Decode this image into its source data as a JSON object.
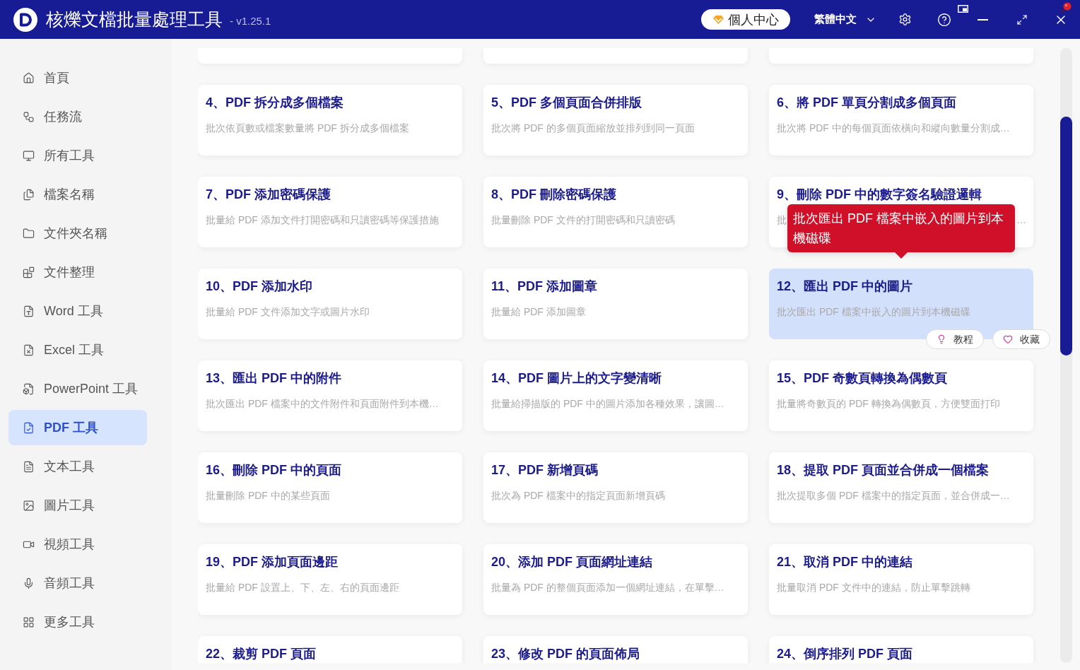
{
  "window": {
    "title": "核爍文檔批量處理工具",
    "version": "- v1.25.1"
  },
  "header": {
    "account_button": "個人中心",
    "language": "繁體中文"
  },
  "sidebar": {
    "items": [
      {
        "label": "首頁",
        "selected": false
      },
      {
        "label": "任務流",
        "selected": false
      },
      {
        "label": "所有工具",
        "selected": false
      },
      {
        "label": "檔案名稱",
        "selected": false
      },
      {
        "label": "文件夾名稱",
        "selected": false
      },
      {
        "label": "文件整理",
        "selected": false
      },
      {
        "label": "Word 工具",
        "selected": false
      },
      {
        "label": "Excel 工具",
        "selected": false
      },
      {
        "label": "PowerPoint 工具",
        "selected": false
      },
      {
        "label": "PDF 工具",
        "selected": true
      },
      {
        "label": "文本工具",
        "selected": false
      },
      {
        "label": "圖片工具",
        "selected": false
      },
      {
        "label": "視頻工具",
        "selected": false
      },
      {
        "label": "音頻工具",
        "selected": false
      },
      {
        "label": "更多工具",
        "selected": false
      }
    ]
  },
  "cards": [
    {
      "title": "4、PDF 拆分成多個檔案",
      "description": "批次依頁數或檔案數量將 PDF 拆分成多個檔案",
      "hovered": false
    },
    {
      "title": "5、PDF 多個頁面合併排版",
      "description": "批次將 PDF 的多個頁面縮放並排列到同一頁面",
      "hovered": false
    },
    {
      "title": "6、將 PDF 單頁分割成多個頁面",
      "description": "批次將 PDF 中的每個頁面依橫向和縱向數量分割成…",
      "hovered": false
    },
    {
      "title": "7、PDF 添加密碼保護",
      "description": "批量給 PDF 添加文件打開密碼和只讀密碼等保護措施",
      "hovered": false
    },
    {
      "title": "8、PDF 刪除密碼保護",
      "description": "批量刪除 PDF 文件的打開密碼和只讀密碼",
      "hovered": false
    },
    {
      "title": "9、刪除 PDF 中的數字簽名驗證邏輯",
      "description": "批",
      "description_end": "…",
      "hovered": false
    },
    {
      "title": "10、PDF 添加水印",
      "description": "批量給 PDF 文件添加文字或圖片水印",
      "hovered": false
    },
    {
      "title": "11、PDF 添加圖章",
      "description": "批量給 PDF 添加圖章",
      "hovered": false
    },
    {
      "title": "12、匯出 PDF 中的圖片",
      "description": "批次匯出 PDF 檔案中嵌入的圖片到本機磁碟",
      "hovered": true,
      "tooltip": "批次匯出 PDF 檔案中嵌入的圖片到本機磁碟",
      "actions": [
        "教程",
        "收藏"
      ]
    },
    {
      "title": "13、匯出 PDF 中的附件",
      "description": "批次匯出 PDF 檔案中的文件附件和頁面附件到本機…",
      "hovered": false
    },
    {
      "title": "14、PDF 圖片上的文字變清晰",
      "description": "批量給掃描版的 PDF 中的圖片添加各種效果，讓圖…",
      "hovered": false
    },
    {
      "title": "15、PDF 奇數頁轉換為偶數頁",
      "description": "批量將奇數頁的 PDF 轉換為偶數頁，方便雙面打印",
      "hovered": false
    },
    {
      "title": "16、刪除 PDF 中的頁面",
      "description": "批量刪除 PDF 中的某些頁面",
      "hovered": false
    },
    {
      "title": "17、PDF 新增頁碼",
      "description": "批次為 PDF 檔案中的指定頁面新增頁碼",
      "hovered": false
    },
    {
      "title": "18、提取 PDF 頁面並合併成一個檔案",
      "description": "批次提取多個 PDF 檔案中的指定頁面，並合併成一…",
      "hovered": false
    },
    {
      "title": "19、PDF 添加頁面邊距",
      "description": "批量給 PDF 設置上、下、左、右的頁面邊距",
      "hovered": false
    },
    {
      "title": "20、添加 PDF 頁面網址連結",
      "description": "批量為 PDF 的整個頁面添加一個網址連結，在單擊…",
      "hovered": false
    },
    {
      "title": "21、取消 PDF 中的連結",
      "description": "批量取消 PDF 文件中的連結，防止單擊跳轉",
      "hovered": false
    },
    {
      "title": "22、裁剪 PDF 頁面",
      "hovered": false
    },
    {
      "title": "23、修改 PDF 的頁面佈局",
      "hovered": false
    },
    {
      "title": "24、倒序排列 PDF 頁面",
      "hovered": false
    }
  ]
}
